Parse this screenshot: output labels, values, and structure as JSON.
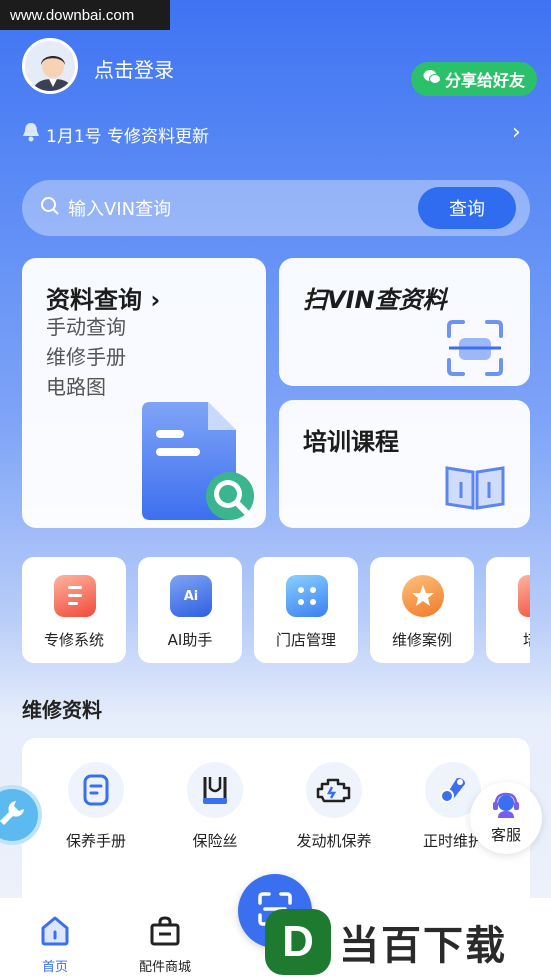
{
  "watermark_top": "www.downbai.com",
  "header": {
    "login_text": "点击登录",
    "share_label": "分享给好友"
  },
  "notice": {
    "text": "1月1号 专修资料更新"
  },
  "search": {
    "placeholder": "输入VIN查询",
    "button_label": "查询"
  },
  "cards": {
    "data_query": {
      "title": "资料查询",
      "items": [
        "手动查询",
        "维修手册",
        "电路图"
      ]
    },
    "scan_vin": {
      "title": "扫VIN查资料"
    },
    "training": {
      "title": "培训课程"
    }
  },
  "quick_items": [
    {
      "label": "专修系统",
      "icon": "doc-stack-icon",
      "color": "#f05a45"
    },
    {
      "label": "AI助手",
      "icon": "ai-icon",
      "color": "#3a6ff0",
      "icon_text": "Ai"
    },
    {
      "label": "门店管理",
      "icon": "store-icon",
      "color": "#3a8ff0"
    },
    {
      "label": "维修案例",
      "icon": "star-icon",
      "color": "#f08a3a"
    },
    {
      "label": "培训",
      "icon": "training-icon",
      "color": "#f05a45"
    }
  ],
  "section_title": "维修资料",
  "maintenance_items": [
    {
      "label": "保养手册",
      "icon": "manual-icon"
    },
    {
      "label": "保险丝",
      "icon": "fuse-icon"
    },
    {
      "label": "发动机保养",
      "icon": "engine-icon"
    },
    {
      "label": "正时维护",
      "icon": "timing-icon"
    }
  ],
  "service": {
    "label": "客服"
  },
  "tabbar": {
    "home_label": "首页",
    "shop_label": "配件商城"
  },
  "watermark_bottom": {
    "letter": "D",
    "text": "当百下载"
  },
  "colors": {
    "primary": "#3a6ff0",
    "share_green": "#2bc16b"
  }
}
